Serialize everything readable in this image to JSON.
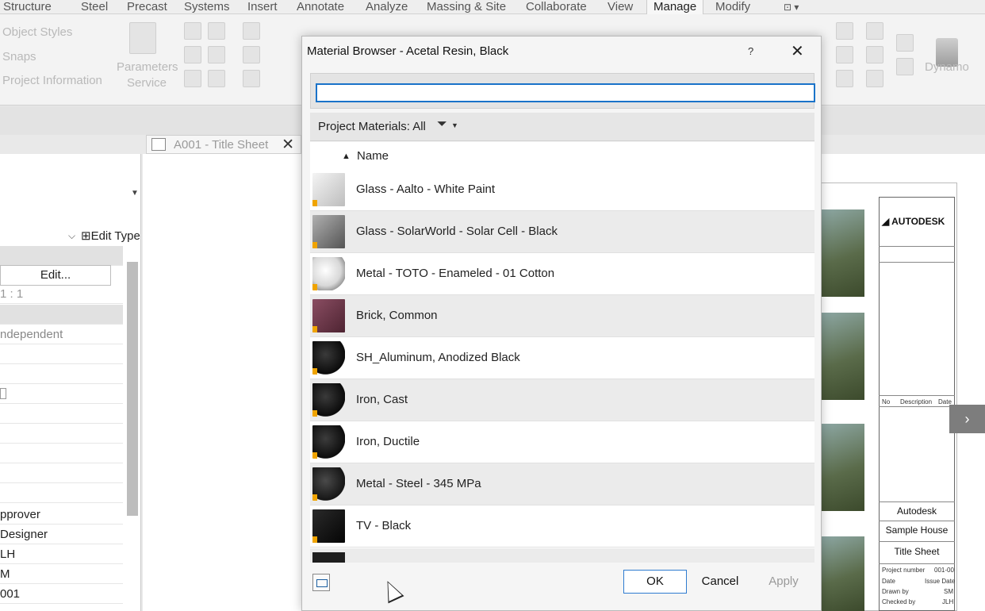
{
  "menu": {
    "tabs": [
      "Structure",
      "Steel",
      "Precast",
      "Systems",
      "Insert",
      "Annotate",
      "Analyze",
      "Massing & Site",
      "Collaborate",
      "View",
      "Manage",
      "Modify"
    ],
    "active": "Manage"
  },
  "ribbon": {
    "object_styles": "Object  Styles",
    "snaps": "Snaps",
    "project_information": "Project  Information",
    "parameters_service_line1": "Parameters",
    "parameters_service_line2": "Service",
    "dynamo": "Dynamo"
  },
  "view_tab": {
    "title": "A001 - Title Sheet",
    "close_glyph": "✕"
  },
  "properties": {
    "edit_type": "Edit Type",
    "edit_button": "Edit...",
    "scale": "1 : 1",
    "independent": "ndependent",
    "approver": "pprover",
    "designer": "Designer",
    "checked": "LH",
    "drawn": "M",
    "sheet_number": "001"
  },
  "sheet": {
    "logo": "AUTODESK",
    "no": "No",
    "description": "Description",
    "date": "Date",
    "company": "Autodesk",
    "project": "Sample House",
    "sheet_name": "Title Sheet",
    "project_number_label": "Project number",
    "project_number": "001-00",
    "date_label": "Date",
    "issue_date": "Issue Date",
    "drawn_by_label": "Drawn by",
    "drawn_by": "SM",
    "checked_by_label": "Checked by",
    "checked_by": "JLH"
  },
  "dialog": {
    "title": "Material Browser - Acetal Resin, Black",
    "help": "?",
    "close": "✕",
    "search": {
      "value": "",
      "placeholder": ""
    },
    "filter_label": "Project Materials: All",
    "column_name": "Name",
    "materials": [
      {
        "name": "Glass - Aalto - White Paint",
        "swatch": "#d8d8d8"
      },
      {
        "name": "Glass - SolarWorld - Solar Cell - Black",
        "swatch": "#8a8a8a"
      },
      {
        "name": "Metal - TOTO - Enameled - 01 Cotton",
        "swatch": "#e8e8e8"
      },
      {
        "name": "Brick, Common",
        "swatch": "#6d3a4a"
      },
      {
        "name": "SH_Aluminum, Anodized Black",
        "swatch": "#151515"
      },
      {
        "name": "Iron, Cast",
        "swatch": "#181818"
      },
      {
        "name": "Iron, Ductile",
        "swatch": "#1a1a1a"
      },
      {
        "name": "Metal - Steel - 345 MPa",
        "swatch": "#222222"
      },
      {
        "name": "TV - Black",
        "swatch": "#111111"
      }
    ],
    "buttons": {
      "ok": "OK",
      "cancel": "Cancel",
      "apply": "Apply"
    }
  },
  "colors": {
    "accent": "#1a73c9",
    "row_alt": "#ebebeb",
    "swatch_flag": "#f0a400"
  }
}
